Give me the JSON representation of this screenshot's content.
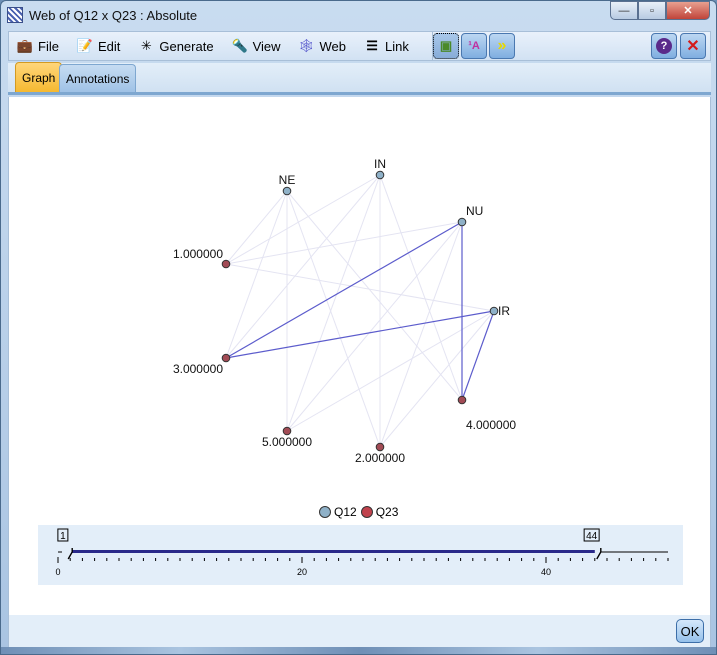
{
  "window": {
    "title": "Web of Q12 x Q23 : Absolute",
    "controls": {
      "minimize": "—",
      "maximize": "▫",
      "close": "✕"
    }
  },
  "menubar": {
    "items": [
      {
        "label": "File",
        "icon": "briefcase-icon",
        "glyph": "💼"
      },
      {
        "label": "Edit",
        "icon": "edit-icon",
        "glyph": "📝"
      },
      {
        "label": "Generate",
        "icon": "generate-icon",
        "glyph": "✳"
      },
      {
        "label": "View",
        "icon": "flashlight-icon",
        "glyph": "🔦"
      },
      {
        "label": "Web",
        "icon": "web-icon",
        "glyph": "🕸"
      },
      {
        "label": "Link",
        "icon": "link-lines-icon",
        "glyph": "☰"
      }
    ],
    "toolbar": [
      {
        "name": "select-mode-button",
        "icon": "select-icon",
        "glyph": "▣"
      },
      {
        "name": "sort-button",
        "icon": "sort-icon",
        "glyph": "¹A"
      },
      {
        "name": "more-button",
        "icon": "double-chevron-icon",
        "glyph": "»"
      }
    ],
    "help_glyph": "?",
    "close_glyph": "✕"
  },
  "tabs": [
    {
      "label": "Graph",
      "selected": true
    },
    {
      "label": "Annotations",
      "selected": false
    }
  ],
  "colors": {
    "q12_node": "#8fb1c8",
    "q23_node": "#a24b55",
    "strong_link": "#5c5ccc",
    "weak_link": "#e4e4f2"
  },
  "graph": {
    "q12_nodes": [
      {
        "id": "NE",
        "label": "NE"
      },
      {
        "id": "IN",
        "label": "IN"
      },
      {
        "id": "NU",
        "label": "NU"
      },
      {
        "id": "IR",
        "label": "IR"
      }
    ],
    "q23_nodes": [
      {
        "id": "1",
        "label": "1.000000"
      },
      {
        "id": "3",
        "label": "3.000000"
      },
      {
        "id": "5",
        "label": "5.000000"
      },
      {
        "id": "2",
        "label": "2.000000"
      },
      {
        "id": "4",
        "label": "4.000000"
      }
    ],
    "strong_links": [
      [
        "NU",
        "3"
      ],
      [
        "IR",
        "3"
      ],
      [
        "NU",
        "4"
      ],
      [
        "IR",
        "4"
      ]
    ],
    "weak_links": [
      [
        "NE",
        "1"
      ],
      [
        "NE",
        "3"
      ],
      [
        "NE",
        "5"
      ],
      [
        "NE",
        "2"
      ],
      [
        "NE",
        "4"
      ],
      [
        "IN",
        "1"
      ],
      [
        "IN",
        "3"
      ],
      [
        "IN",
        "5"
      ],
      [
        "IN",
        "2"
      ],
      [
        "IN",
        "4"
      ],
      [
        "NU",
        "1"
      ],
      [
        "NU",
        "5"
      ],
      [
        "NU",
        "2"
      ],
      [
        "IR",
        "1"
      ],
      [
        "IR",
        "5"
      ],
      [
        "IR",
        "2"
      ]
    ]
  },
  "legend": [
    {
      "label": "Q12",
      "color": "#8fb1c8"
    },
    {
      "label": "Q23",
      "color": "#a24b55"
    }
  ],
  "slider": {
    "min": 0,
    "max": 50,
    "low_value": "1",
    "high_value": "44",
    "tick_labels": [
      "0",
      "20",
      "40"
    ]
  },
  "footer": {
    "ok_label": "OK"
  }
}
